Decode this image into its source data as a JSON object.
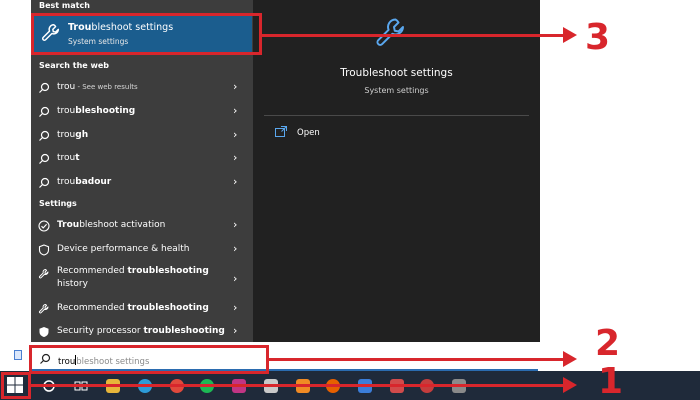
{
  "colors": {
    "left_pane_bg": "#3d3d3d",
    "right_pane_bg": "#212121",
    "highlight": "#1b5d8e",
    "accent_blue": "#5aa7ee",
    "annotation_red": "#d8262c",
    "taskbar_bg": "#1f2a3a"
  },
  "left_pane": {
    "best_match_header": "Best match",
    "best_match": {
      "title_bold": "Trou",
      "title_rest": "bleshoot settings",
      "subtitle": "System settings",
      "icon": "wrench-icon"
    },
    "web_header": "Search the web",
    "web_results": [
      {
        "normal": "trou",
        "bold": "",
        "suffix": " - See web results",
        "icon": "search-icon"
      },
      {
        "normal": "trou",
        "bold": "bleshooting",
        "suffix": "",
        "icon": "search-icon"
      },
      {
        "normal": "trou",
        "bold": "gh",
        "suffix": "",
        "icon": "search-icon"
      },
      {
        "normal": "trou",
        "bold": "t",
        "suffix": "",
        "icon": "search-icon"
      },
      {
        "normal": "trou",
        "bold": "badour",
        "suffix": "",
        "icon": "search-icon"
      }
    ],
    "settings_header": "Settings",
    "settings_results": [
      {
        "pre": "",
        "bold": "Trou",
        "post": "bleshoot activation",
        "icon": "check-circle-icon"
      },
      {
        "pre": "Device performance & health",
        "bold": "",
        "post": "",
        "icon": "shield-icon"
      },
      {
        "pre": "Recommended ",
        "bold": "troubleshooting",
        "post": " history",
        "icon": "wrench-icon"
      },
      {
        "pre": "Recommended ",
        "bold": "troubleshooting",
        "post": "",
        "icon": "wrench-icon"
      },
      {
        "pre": "Security processor ",
        "bold": "troubleshooting",
        "post": "",
        "icon": "shield-icon"
      }
    ],
    "chevron": "›"
  },
  "right_pane": {
    "title": "Troubleshoot settings",
    "subtitle": "System settings",
    "open_label": "Open",
    "icon": "wrench-icon"
  },
  "search": {
    "typed": "trou",
    "suggestion": "bleshoot settings",
    "icon": "search-icon"
  },
  "annotations": {
    "callout_1": "1",
    "callout_2": "2",
    "callout_3": "3"
  },
  "taskbar": {
    "icons": [
      "windows-start-icon",
      "cortana-icon",
      "task-view-icon",
      "file-explorer-icon",
      "edge-icon",
      "chrome-icon",
      "spotify-icon",
      "instagram-icon",
      "media-icon",
      "app-icon",
      "firefox-icon",
      "app-icon",
      "app-icon",
      "app-icon",
      "app-icon",
      "settings-icon"
    ]
  }
}
